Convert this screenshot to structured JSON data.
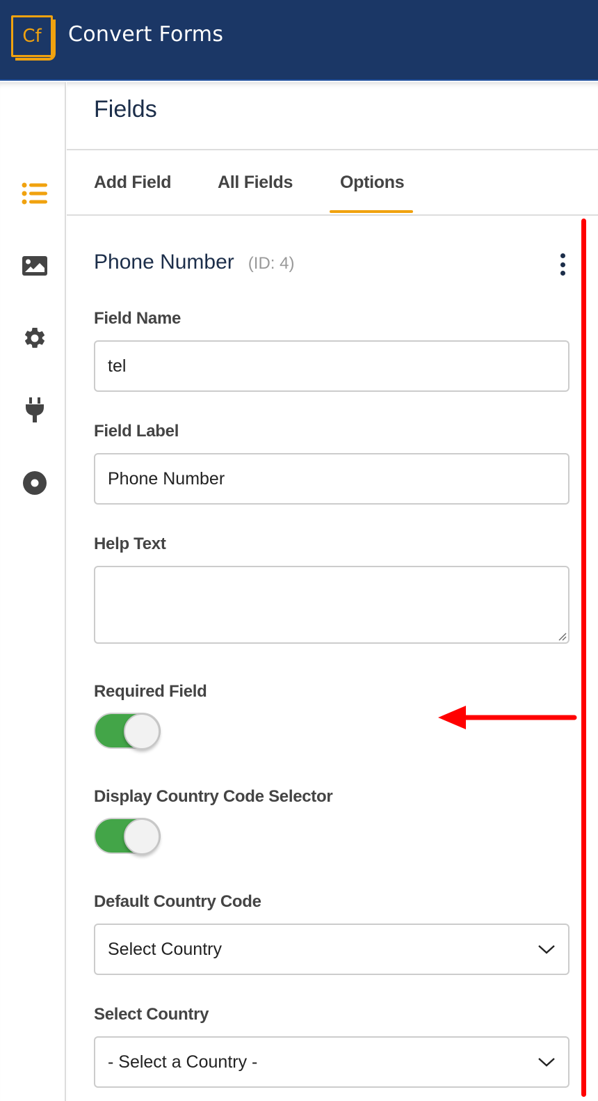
{
  "app": {
    "logo_text": "Cf",
    "title": "Convert Forms"
  },
  "colors": {
    "header_bg": "#1b3766",
    "accent": "#f0a20f",
    "toggle_on": "#43a548",
    "annotation": "#ff0000"
  },
  "sidebar": {
    "items": [
      {
        "icon": "list-icon",
        "active": true
      },
      {
        "icon": "image-icon",
        "active": false
      },
      {
        "icon": "gear-icon",
        "active": false
      },
      {
        "icon": "plug-icon",
        "active": false
      },
      {
        "icon": "record-icon",
        "active": false
      }
    ]
  },
  "panel": {
    "title": "Fields",
    "tabs": [
      {
        "label": "Add Field",
        "active": false
      },
      {
        "label": "All Fields",
        "active": false
      },
      {
        "label": "Options",
        "active": true
      }
    ]
  },
  "field": {
    "title": "Phone Number",
    "id_label": "(ID: 4)",
    "options": {
      "field_name": {
        "label": "Field Name",
        "value": "tel"
      },
      "field_label": {
        "label": "Field Label",
        "value": "Phone Number"
      },
      "help_text": {
        "label": "Help Text",
        "value": ""
      },
      "required": {
        "label": "Required Field",
        "on": true
      },
      "country_selector": {
        "label": "Display Country Code Selector",
        "on": true
      },
      "default_country_code": {
        "label": "Default Country Code",
        "value": "Select Country"
      },
      "select_country": {
        "label": "Select Country",
        "value": "- Select a Country -"
      }
    }
  }
}
